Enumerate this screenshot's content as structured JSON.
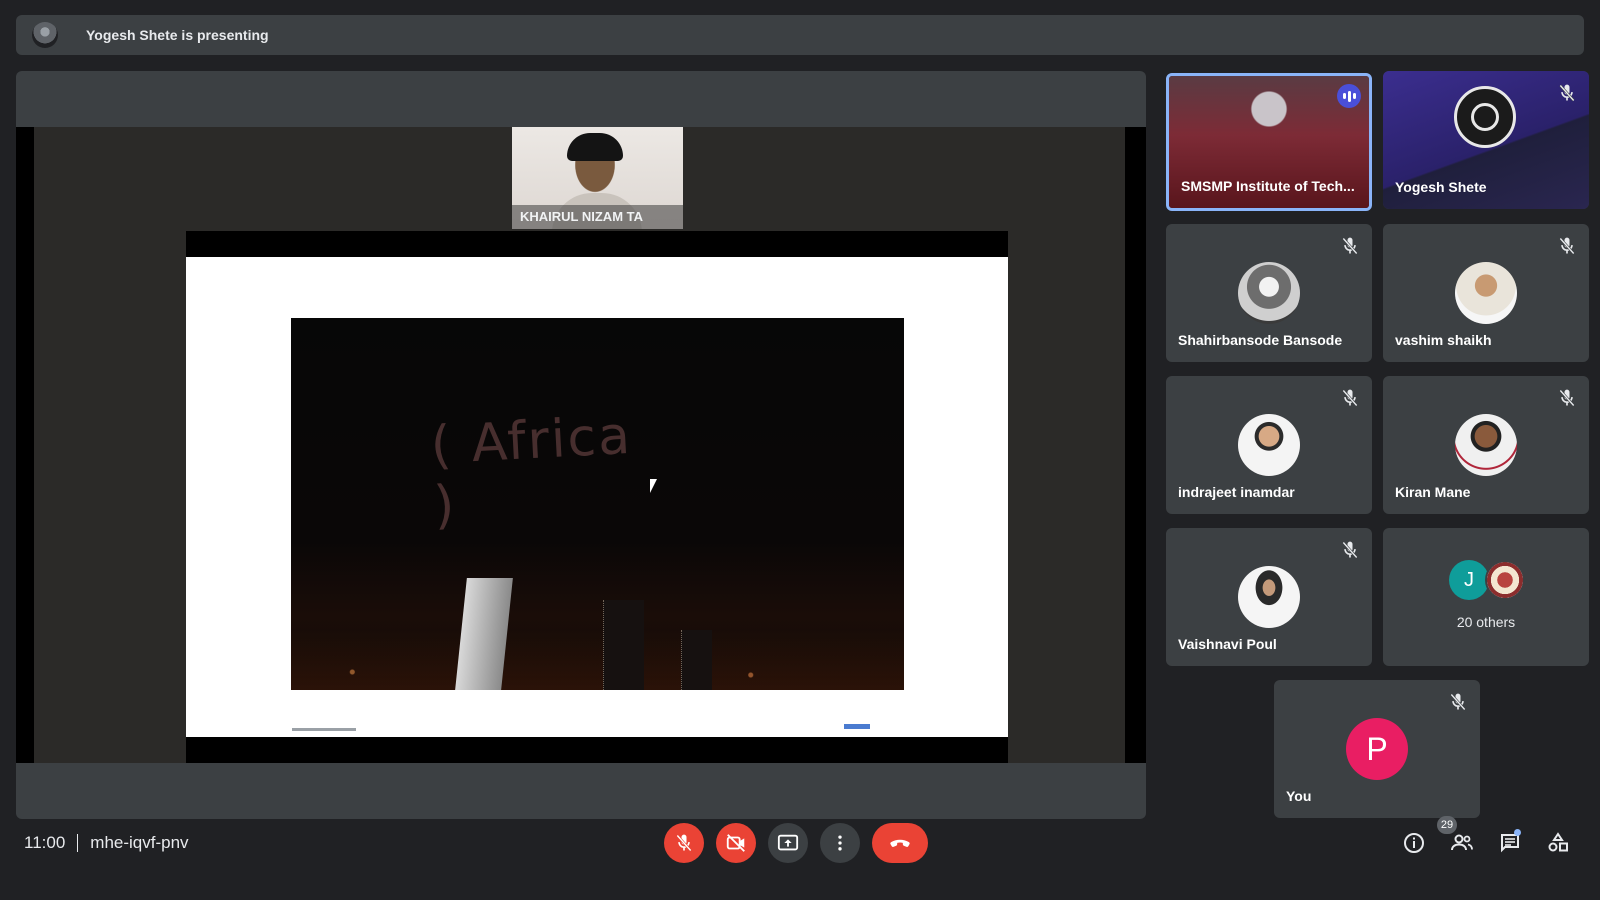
{
  "banner": {
    "text": "Yogesh Shete is presenting",
    "avatar_icon": "presenter-avatar"
  },
  "presentation": {
    "pip_name": "KHAIRUL NIZAM TA",
    "video_text": "( Africa )"
  },
  "participants": [
    {
      "name": "SMSMP Institute of Tech...",
      "speaking": true,
      "muted": false,
      "selected": true
    },
    {
      "name": "Yogesh Shete",
      "muted": true,
      "camera_off": true
    },
    {
      "name": "Shahirbansode Bansode",
      "muted": true
    },
    {
      "name": "vashim shaikh",
      "muted": true
    },
    {
      "name": "indrajeet inamdar",
      "muted": true
    },
    {
      "name": "Kiran Mane",
      "muted": true
    },
    {
      "name": "Vaishnavi Poul",
      "muted": true
    }
  ],
  "others": {
    "initial": "J",
    "label": "20 others"
  },
  "self_tile": {
    "name": "You",
    "initial": "P",
    "avatar_color": "#e91e63",
    "muted": true
  },
  "meeting": {
    "time": "11:00",
    "code": "mhe-iqvf-pnv"
  },
  "controls": {
    "mic": "mic-off-icon",
    "camera": "camera-off-icon",
    "present": "present-screen-icon",
    "more": "more-options-icon",
    "end_call": "hang-up-icon",
    "end_call_color": "#ea4335"
  },
  "side_controls": {
    "people_count": "29",
    "info": "info-icon",
    "people": "people-icon",
    "chat": "chat-icon",
    "activities": "activities-icon"
  },
  "colors": {
    "background": "#202124",
    "tile": "#3c4043",
    "accent": "#8ab4f8",
    "speaking": "#4a4fd9"
  }
}
